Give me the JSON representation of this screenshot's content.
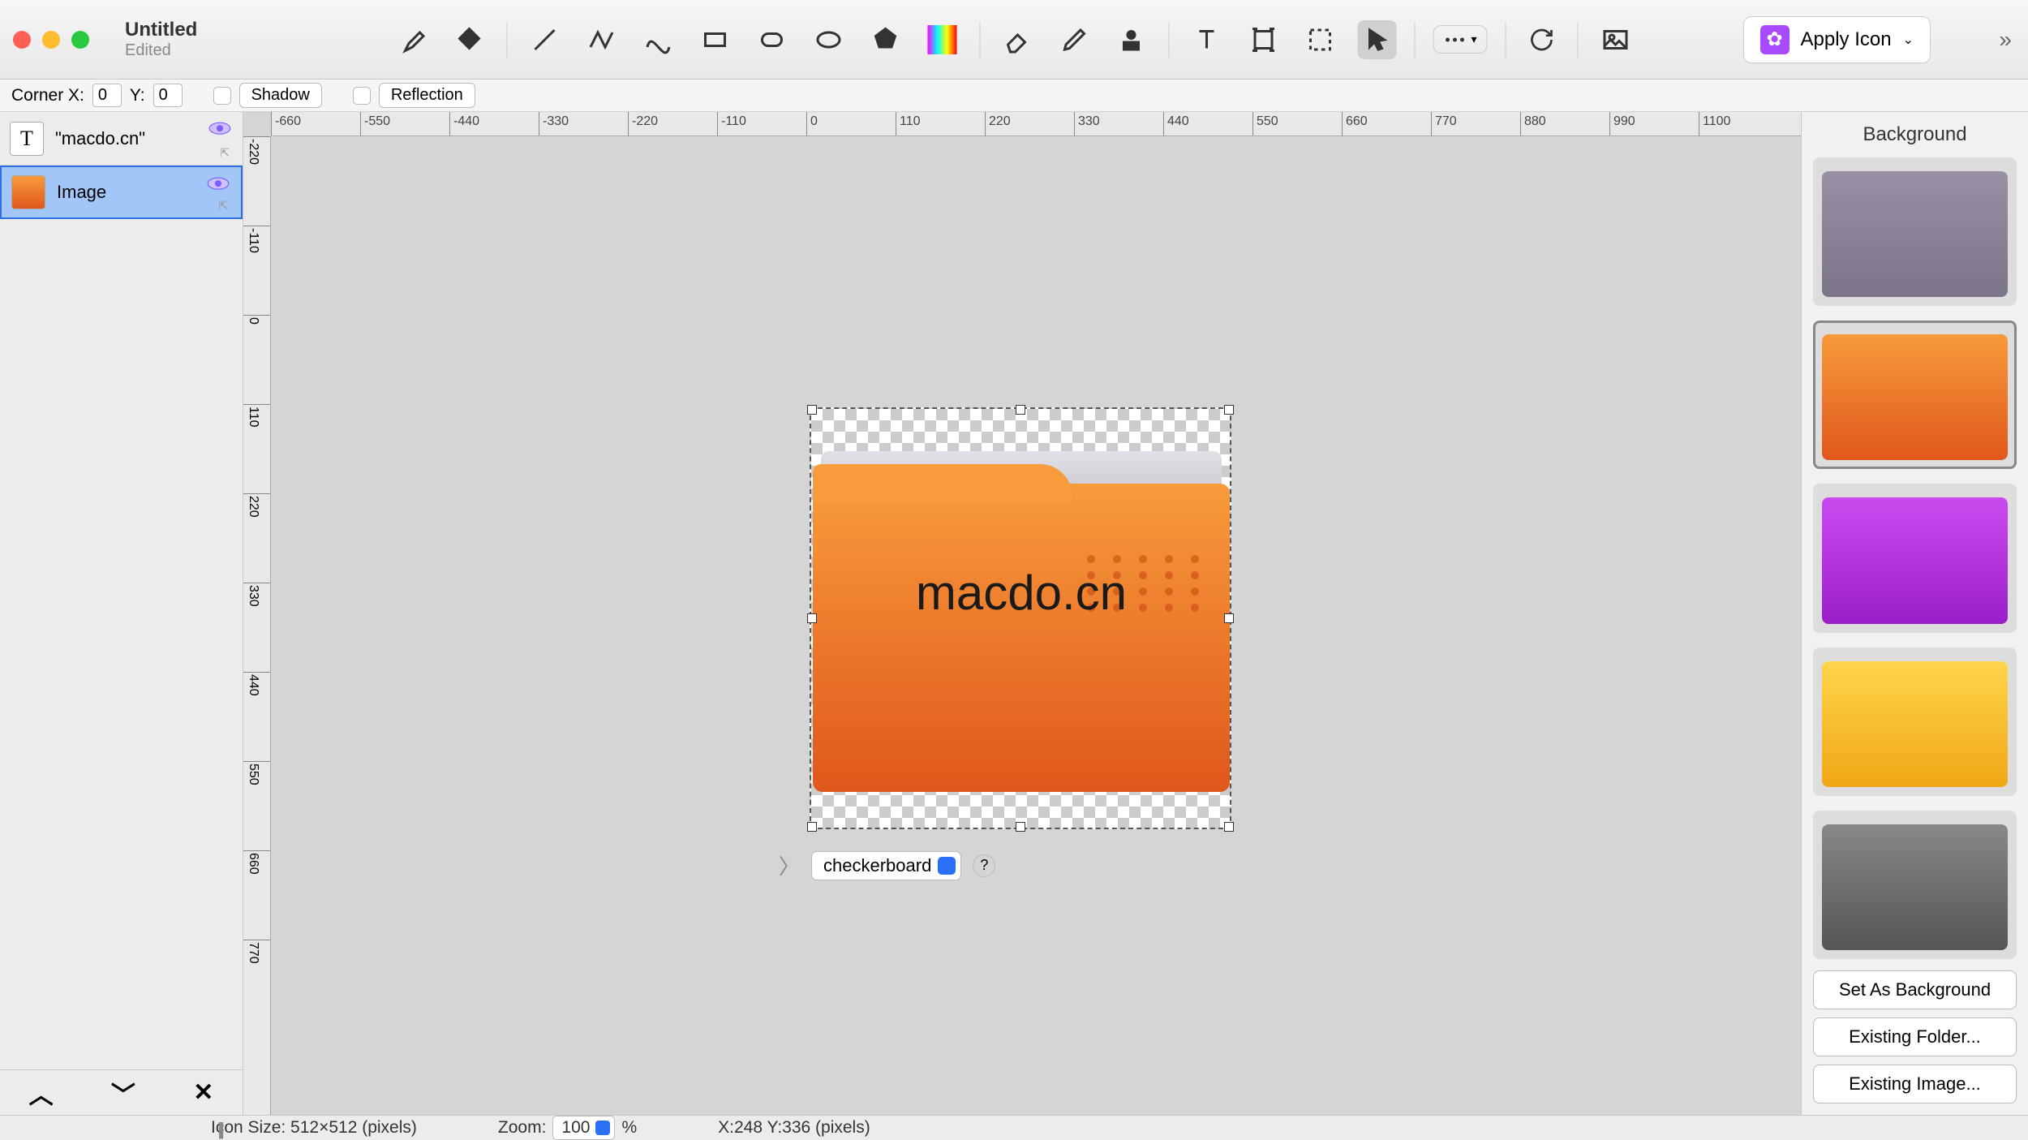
{
  "title": {
    "main": "Untitled",
    "sub": "Edited"
  },
  "applyIcon": "Apply Icon",
  "optbar": {
    "cornerX": "Corner X:",
    "yLabel": "Y:",
    "cx": "0",
    "cy": "0",
    "shadow": "Shadow",
    "reflection": "Reflection"
  },
  "layers": [
    {
      "name": "\"macdo.cn\"",
      "type": "text"
    },
    {
      "name": "Image",
      "type": "image"
    }
  ],
  "rulerH": [
    "-660",
    "-550",
    "-440",
    "-330",
    "-220",
    "-110",
    "0",
    "110",
    "220",
    "330",
    "440",
    "550",
    "660",
    "770",
    "880",
    "990",
    "1100"
  ],
  "rulerV": [
    "-220",
    "-110",
    "0",
    "110",
    "220",
    "330",
    "440",
    "550",
    "660",
    "770"
  ],
  "canvasText": "macdo.cn",
  "checker": "checkerboard",
  "side": {
    "title": "Background",
    "buttons": [
      "Set As Background",
      "Existing Folder...",
      "Existing Image..."
    ],
    "items": [
      {
        "color": "linear-gradient(#9a90a6,#7c7488)"
      },
      {
        "color": "linear-gradient(#f89b3c,#e0571b)",
        "selected": true
      },
      {
        "color": "linear-gradient(#c94bf0,#9b1fc8)"
      },
      {
        "color": "linear-gradient(#ffd54b,#f0a716)"
      },
      {
        "color": "linear-gradient(#888,#555)"
      }
    ]
  },
  "status": {
    "iconSize": "Icon Size: 512×512 (pixels)",
    "zoomLabel": "Zoom:",
    "zoom": "100",
    "pct": "%",
    "cursor": "X:248 Y:336 (pixels)"
  }
}
